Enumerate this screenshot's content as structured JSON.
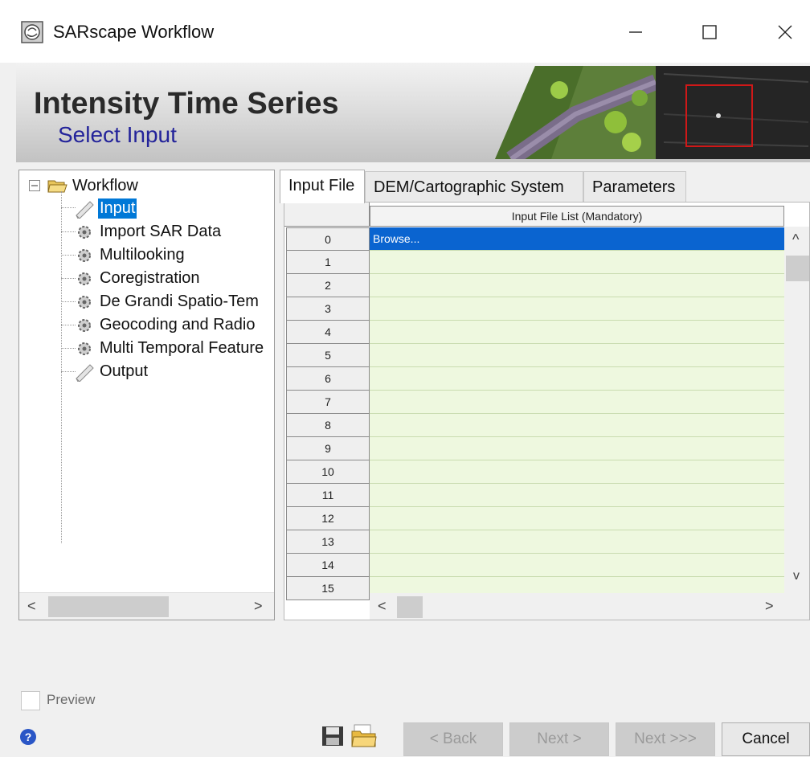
{
  "window": {
    "title": "SARscape Workflow",
    "minimize_glyph": "—",
    "maximize_glyph": "☐",
    "close_glyph": "✕"
  },
  "banner": {
    "title": "Intensity Time Series",
    "subtitle": "Select Input"
  },
  "tree": {
    "root_toggle": "−",
    "root_label": "Workflow",
    "items": [
      {
        "label": "Input",
        "icon": "pencil-icon",
        "selected": true
      },
      {
        "label": "Import SAR Data",
        "icon": "gear-icon",
        "selected": false
      },
      {
        "label": "Multilooking",
        "icon": "gear-icon",
        "selected": false
      },
      {
        "label": "Coregistration",
        "icon": "gear-icon",
        "selected": false
      },
      {
        "label": "De Grandi Spatio-Tem",
        "icon": "gear-icon",
        "selected": false
      },
      {
        "label": "Geocoding and Radio",
        "icon": "gear-icon",
        "selected": false
      },
      {
        "label": "Multi Temporal Feature",
        "icon": "gear-icon",
        "selected": false
      },
      {
        "label": "Output",
        "icon": "pencil-icon",
        "selected": false
      }
    ],
    "scroll_left": "<",
    "scroll_right": ">"
  },
  "tabs": [
    {
      "label": "Input File",
      "active": true
    },
    {
      "label": "DEM/Cartographic System",
      "active": false
    },
    {
      "label": "Parameters",
      "active": false
    }
  ],
  "table": {
    "column_header": "Input File List (Mandatory)",
    "rows": [
      "0",
      "1",
      "2",
      "3",
      "4",
      "5",
      "6",
      "7",
      "8",
      "9",
      "10",
      "11",
      "12",
      "13",
      "14",
      "15"
    ],
    "cells": [
      "Browse...",
      "",
      "",
      "",
      "",
      "",
      "",
      "",
      "",
      "",
      "",
      "",
      "",
      "",
      "",
      ""
    ],
    "scroll_up": "^",
    "scroll_down": "v",
    "scroll_left": "<",
    "scroll_right": ">"
  },
  "footer": {
    "preview_label": "Preview",
    "back_label": "< Back",
    "next_label": "Next >",
    "next_all_label": "Next >>>",
    "cancel_label": "Cancel",
    "help_glyph": "?"
  },
  "colors": {
    "selection": "#0078d7",
    "cell_bg": "#eef8df",
    "subtitle": "#23239a"
  }
}
